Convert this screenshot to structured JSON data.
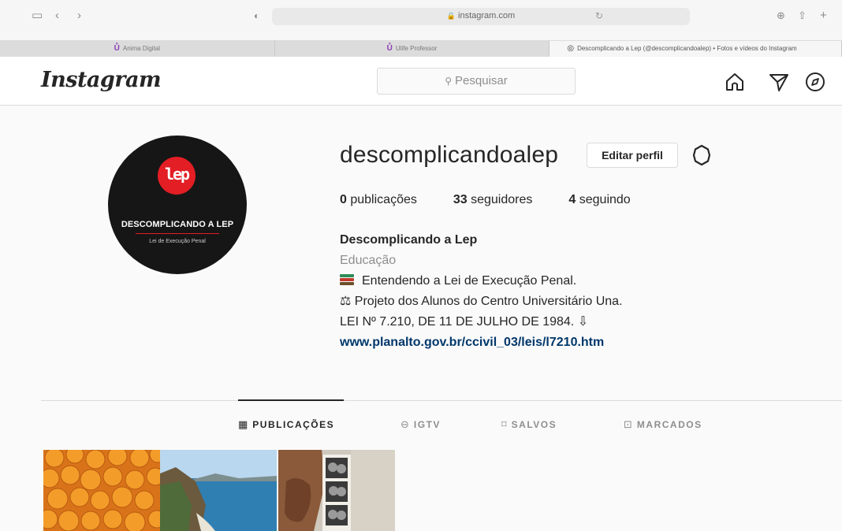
{
  "browser": {
    "url": "instagram.com",
    "tabs": [
      {
        "label": "Anima Digital",
        "icon": "U-logo"
      },
      {
        "label": "Ulife Professor",
        "icon": "U-logo"
      },
      {
        "label": "Descomplicando a Lep (@descomplicandoalep) • Fotos e vídeos do Instagram",
        "icon": "instagram-icon",
        "active": true
      }
    ]
  },
  "header": {
    "logo": "Instagram",
    "search_placeholder": "Pesquisar",
    "icons": [
      "home-icon",
      "direct-icon",
      "explore-icon"
    ]
  },
  "profile": {
    "avatar": {
      "badge_text": "lep",
      "title": "DESCOMPLICANDO A LEP",
      "subtitle": "Lei de Execução Penal",
      "badge_color": "#e31e24"
    },
    "username": "descomplicandoalep",
    "edit_button": "Editar perfil",
    "stats": [
      {
        "count": "0",
        "label": "publicações"
      },
      {
        "count": "33",
        "label": "seguidores"
      },
      {
        "count": "4",
        "label": "seguindo"
      }
    ],
    "full_name": "Descomplicando a Lep",
    "category": "Educação",
    "bio_lines": [
      "Entendendo a Lei de Execução Penal.",
      "⚖ Projeto dos Alunos do Centro Universitário Una.",
      "LEI Nº 7.210, DE 11 DE JULHO DE 1984. ⇩"
    ],
    "link": "www.planalto.gov.br/ccivil_03/leis/l7210.htm"
  },
  "content_tabs": [
    {
      "label": "PUBLICAÇÕES",
      "icon": "grid-icon",
      "active": true
    },
    {
      "label": "IGTV",
      "icon": "igtv-icon"
    },
    {
      "label": "SALVOS",
      "icon": "bookmark-icon"
    },
    {
      "label": "MARCADOS",
      "icon": "tagged-icon"
    }
  ],
  "accent_colors": {
    "link": "#00376b",
    "secondary_text": "#8e8e8e",
    "border": "#dbdbdb"
  }
}
